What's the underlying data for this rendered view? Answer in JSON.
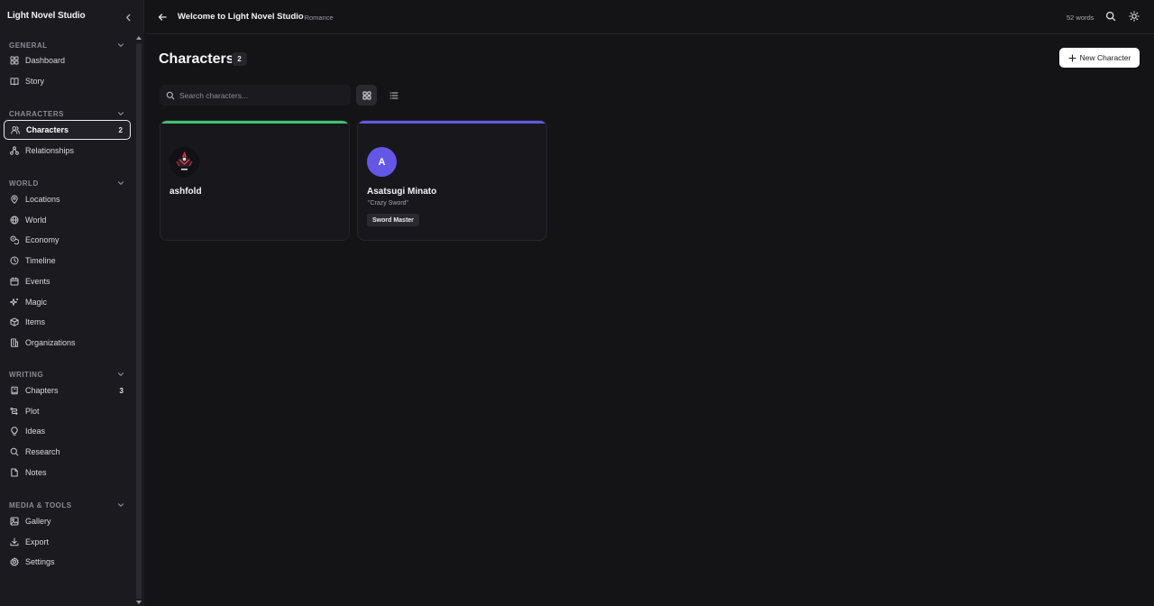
{
  "app": {
    "name": "Light Novel Studio"
  },
  "sidebar": {
    "sections": [
      {
        "title": "GENERAL",
        "items": [
          {
            "label": "Dashboard",
            "icon": "dashboard-icon"
          },
          {
            "label": "Story",
            "icon": "book-icon"
          }
        ]
      },
      {
        "title": "CHARACTERS",
        "items": [
          {
            "label": "Characters",
            "icon": "users-icon",
            "count": "2",
            "active": true
          },
          {
            "label": "Relationships",
            "icon": "relationships-icon"
          }
        ]
      },
      {
        "title": "WORLD",
        "items": [
          {
            "label": "Locations",
            "icon": "map-pin-icon"
          },
          {
            "label": "World",
            "icon": "globe-icon"
          },
          {
            "label": "Economy",
            "icon": "coins-icon"
          },
          {
            "label": "Timeline",
            "icon": "clock-icon"
          },
          {
            "label": "Events",
            "icon": "calendar-icon"
          },
          {
            "label": "Magic",
            "icon": "sparkles-icon"
          },
          {
            "label": "Items",
            "icon": "package-icon"
          },
          {
            "label": "Organizations",
            "icon": "building-icon"
          }
        ]
      },
      {
        "title": "WRITING",
        "items": [
          {
            "label": "Chapters",
            "icon": "chapter-book-icon",
            "count": "3"
          },
          {
            "label": "Plot",
            "icon": "plot-icon"
          },
          {
            "label": "Ideas",
            "icon": "lightbulb-icon"
          },
          {
            "label": "Research",
            "icon": "search-icon"
          },
          {
            "label": "Notes",
            "icon": "note-icon"
          }
        ]
      },
      {
        "title": "MEDIA & TOOLS",
        "items": [
          {
            "label": "Gallery",
            "icon": "image-icon"
          },
          {
            "label": "Export",
            "icon": "download-icon"
          },
          {
            "label": "Settings",
            "icon": "gear-icon"
          }
        ]
      }
    ]
  },
  "topbar": {
    "title": "Welcome to Light Novel Studio",
    "genre": "· Romance",
    "word_count": "52 words"
  },
  "main": {
    "title": "Characters",
    "count": "2",
    "new_button": "New Character",
    "search_placeholder": "Search characters..."
  },
  "characters": [
    {
      "name": "ashfold",
      "alias": "",
      "tag": "",
      "accent": "#3fc16f",
      "avatar_type": "image",
      "initial": ""
    },
    {
      "name": "Asatsugi Minato",
      "alias": "\"Crazy Sword\"",
      "tag": "Sword Master",
      "accent": "#6457e6",
      "avatar_type": "initial",
      "initial": "A"
    }
  ],
  "colors": {
    "background": "#141417",
    "sidebar": "#1b1a1f",
    "accent_green": "#3fc16f",
    "accent_purple": "#6457e6"
  }
}
